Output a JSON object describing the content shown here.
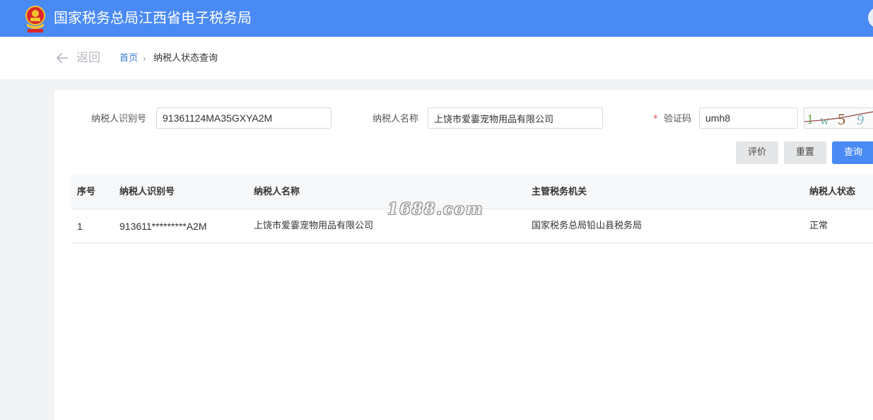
{
  "header": {
    "title": "国家税务总局江西省电子税务局"
  },
  "nav": {
    "back_label": "返回",
    "breadcrumb": {
      "home": "首页",
      "current": "纳税人状态查询"
    }
  },
  "form": {
    "taxpayer_id": {
      "label": "纳税人识别号",
      "value": "91361124MA35GXYA2M"
    },
    "taxpayer_name": {
      "label": "纳税人名称",
      "value": "上饶市爱霎宠物用品有限公司"
    },
    "captcha": {
      "required_mark": "*",
      "label": "验证码",
      "value": "umh8",
      "image_chars": [
        "1",
        "w",
        "5",
        "9"
      ]
    },
    "buttons": {
      "evaluate": "评价",
      "reset": "重置",
      "query": "查询"
    }
  },
  "table": {
    "columns": [
      "序号",
      "纳税人识别号",
      "纳税人名称",
      "主管税务机关",
      "纳税人状态"
    ],
    "rows": [
      [
        "1",
        "913611*********A2M",
        "上饶市爱霎宠物用品有限公司",
        "国家税务总局铅山县税务局",
        "正常"
      ]
    ]
  },
  "watermark": "1688.com",
  "colors": {
    "header_bg": "#4a8af4",
    "primary_button": "#4a8af4",
    "link": "#3a7bd5",
    "required": "#e05050"
  },
  "icons": {
    "emblem": "tax-emblem-icon",
    "back": "arrow-left-icon",
    "separator": "chevron-right-icon"
  }
}
